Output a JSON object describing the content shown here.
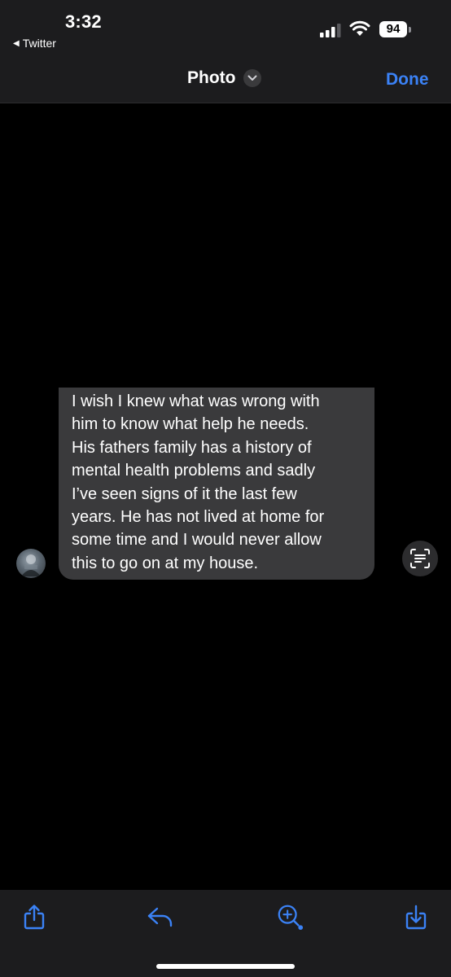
{
  "status_bar": {
    "time": "3:32",
    "back_app": "Twitter",
    "battery": "94",
    "icons": [
      "signal-icon",
      "wifi-icon",
      "battery-icon"
    ]
  },
  "nav": {
    "title": "Photo",
    "done_label": "Done",
    "accent_color": "#3b82f6"
  },
  "message": {
    "text": "I wish I knew what was wrong with\nhim to know what help he needs.\nHis fathers family has a history of\nmental health problems and sadly\nI’ve seen signs of it the last few\nyears. He has not lived at home for\nsome time and I would never allow\nthis to go on at my house.",
    "bubble_color": "#3a3a3c"
  },
  "toolbar": {
    "items": [
      "share-icon",
      "reply-icon",
      "markup-zoom-icon",
      "save-icon"
    ]
  }
}
